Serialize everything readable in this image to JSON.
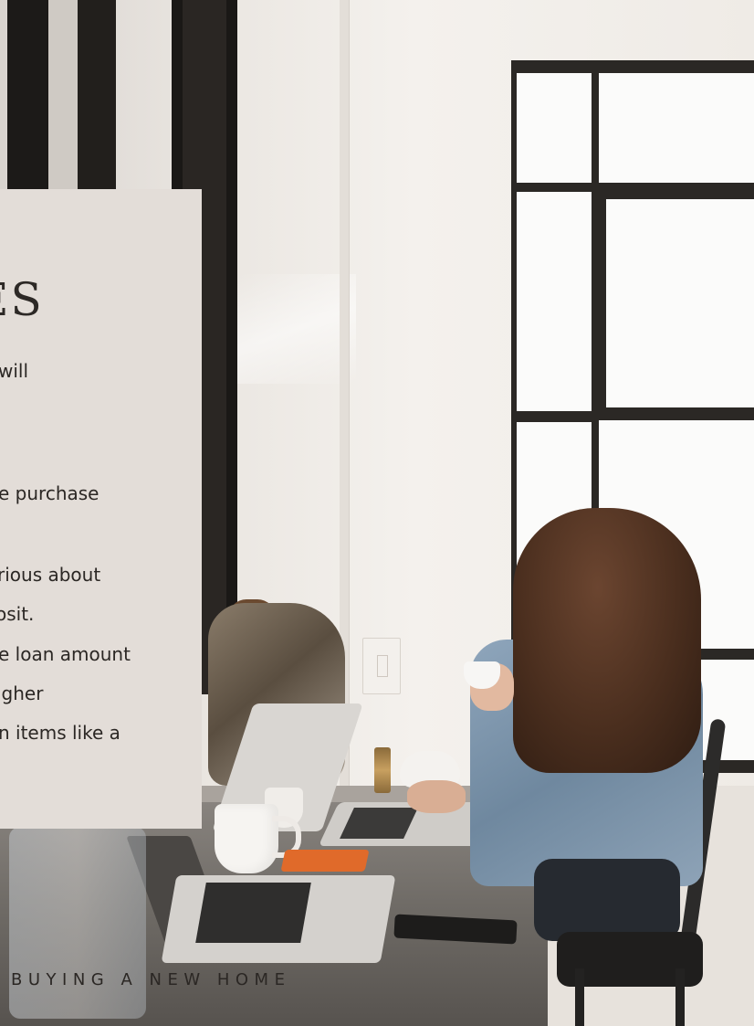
{
  "card": {
    "heading": "ES",
    "lines": [
      "will",
      "e purchase",
      "rious about",
      "osit.",
      "e loan amount",
      "igher",
      "n items like a"
    ]
  },
  "footer": {
    "caption": "BUYING A NEW HOME"
  }
}
